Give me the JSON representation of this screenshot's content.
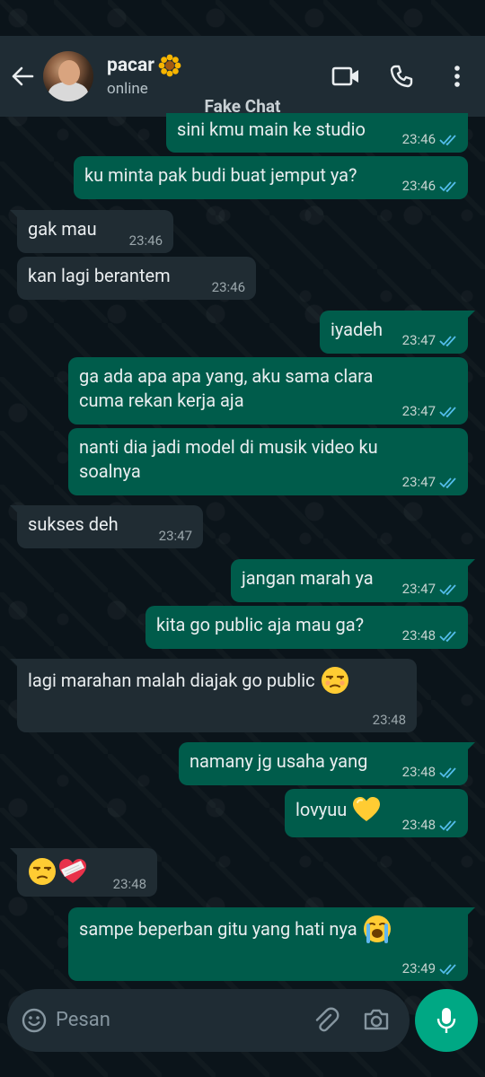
{
  "header": {
    "contact_name": "pacar",
    "status": "online",
    "watermark": "Fake Chat"
  },
  "messages": [
    {
      "text": "sini kmu main ke studio",
      "time": "23:46",
      "dir": "out",
      "read": true
    },
    {
      "text": "ku minta pak budi buat jemput ya?",
      "time": "23:46",
      "dir": "out",
      "read": true
    },
    {
      "text": "gak mau",
      "time": "23:46",
      "dir": "in"
    },
    {
      "text": "kan lagi berantem",
      "time": "23:46",
      "dir": "in"
    },
    {
      "text": "iyadeh",
      "time": "23:47",
      "dir": "out",
      "read": true
    },
    {
      "text": "ga ada apa apa yang, aku sama clara\ncuma rekan kerja aja",
      "time": "23:47",
      "dir": "out",
      "read": true
    },
    {
      "text": "nanti dia jadi model di musik video ku\nsoalnya",
      "time": "23:47",
      "dir": "out",
      "read": true
    },
    {
      "text": "sukses deh",
      "time": "23:47",
      "dir": "in"
    },
    {
      "text": "jangan marah ya",
      "time": "23:47",
      "dir": "out",
      "read": true
    },
    {
      "text": "kita go public aja mau ga?",
      "time": "23:48",
      "dir": "out",
      "read": true
    },
    {
      "text": "lagi marahan malah diajak go public",
      "time": "23:48",
      "dir": "in",
      "emoji": "unamused-face"
    },
    {
      "text": "namany jg usaha yang",
      "time": "23:48",
      "dir": "out",
      "read": true
    },
    {
      "text": "lovyuu",
      "time": "23:48",
      "dir": "out",
      "read": true,
      "emoji": "yellow-heart"
    },
    {
      "text": "",
      "time": "23:48",
      "dir": "in",
      "emoji": "unamused-face, mending-heart"
    },
    {
      "text": "sampe beperban gitu yang hati nya",
      "time": "23:49",
      "dir": "out",
      "read": true,
      "emoji": "loudly-crying-face"
    }
  ],
  "input": {
    "placeholder": "Pesan"
  },
  "colors": {
    "outgoing": "#005c4b",
    "incoming": "#202c33",
    "header": "#1f2c34",
    "accent": "#00a884",
    "read_tick": "#53bdeb"
  }
}
